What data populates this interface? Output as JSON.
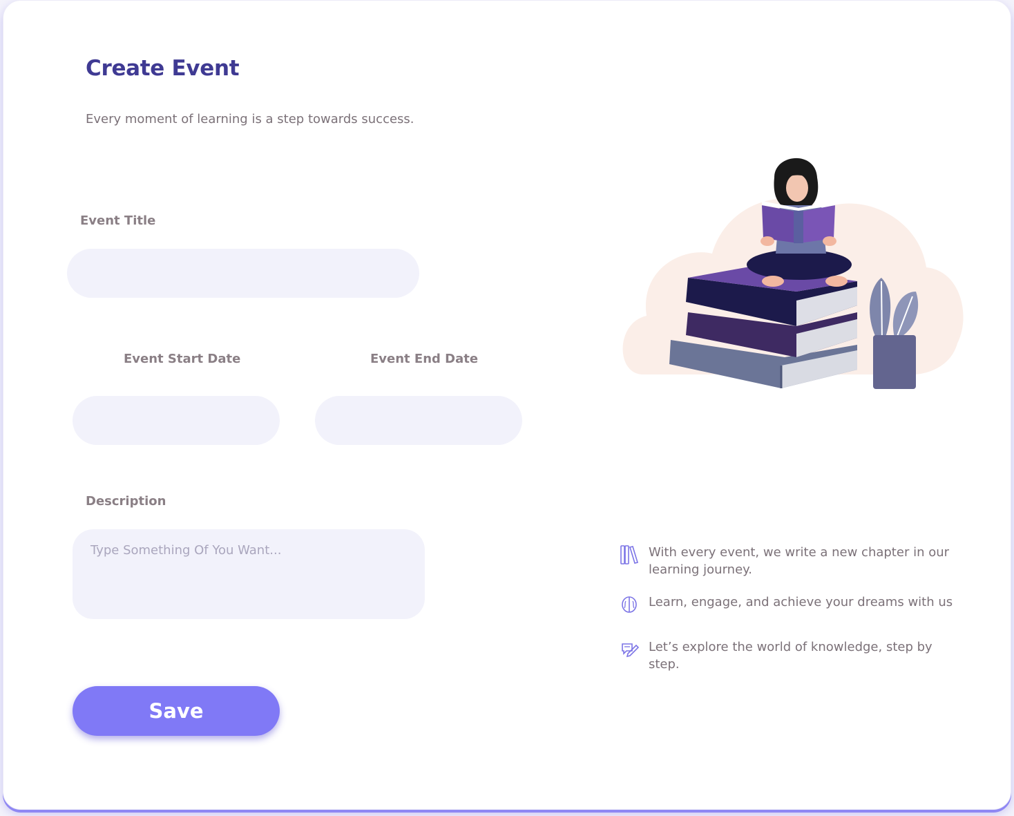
{
  "header": {
    "title": "Create Event",
    "subtitle": "Every moment of learning is a step towards success."
  },
  "form": {
    "title_label": "Event Title",
    "title_value": "",
    "start_label": "Event Start Date",
    "start_value": "",
    "end_label": "Event End Date",
    "end_value": "",
    "description_label": "Description",
    "description_placeholder": "Type Something Of You Want...",
    "description_value": "",
    "save_label": "Save"
  },
  "features": [
    {
      "icon": "books-icon",
      "text": "With every event, we write a new chapter in our learning journey."
    },
    {
      "icon": "brain-icon",
      "text": "Learn, engage, and achieve your dreams with us"
    },
    {
      "icon": "pencil-note-icon",
      "text": "Let’s explore the world of knowledge, step by step."
    }
  ],
  "colors": {
    "accent": "#8079f6",
    "title": "#3f3a93",
    "field_bg": "#f2f2fb",
    "label": "#8a7f85"
  },
  "illustration": "woman-reading-on-books-illustration"
}
